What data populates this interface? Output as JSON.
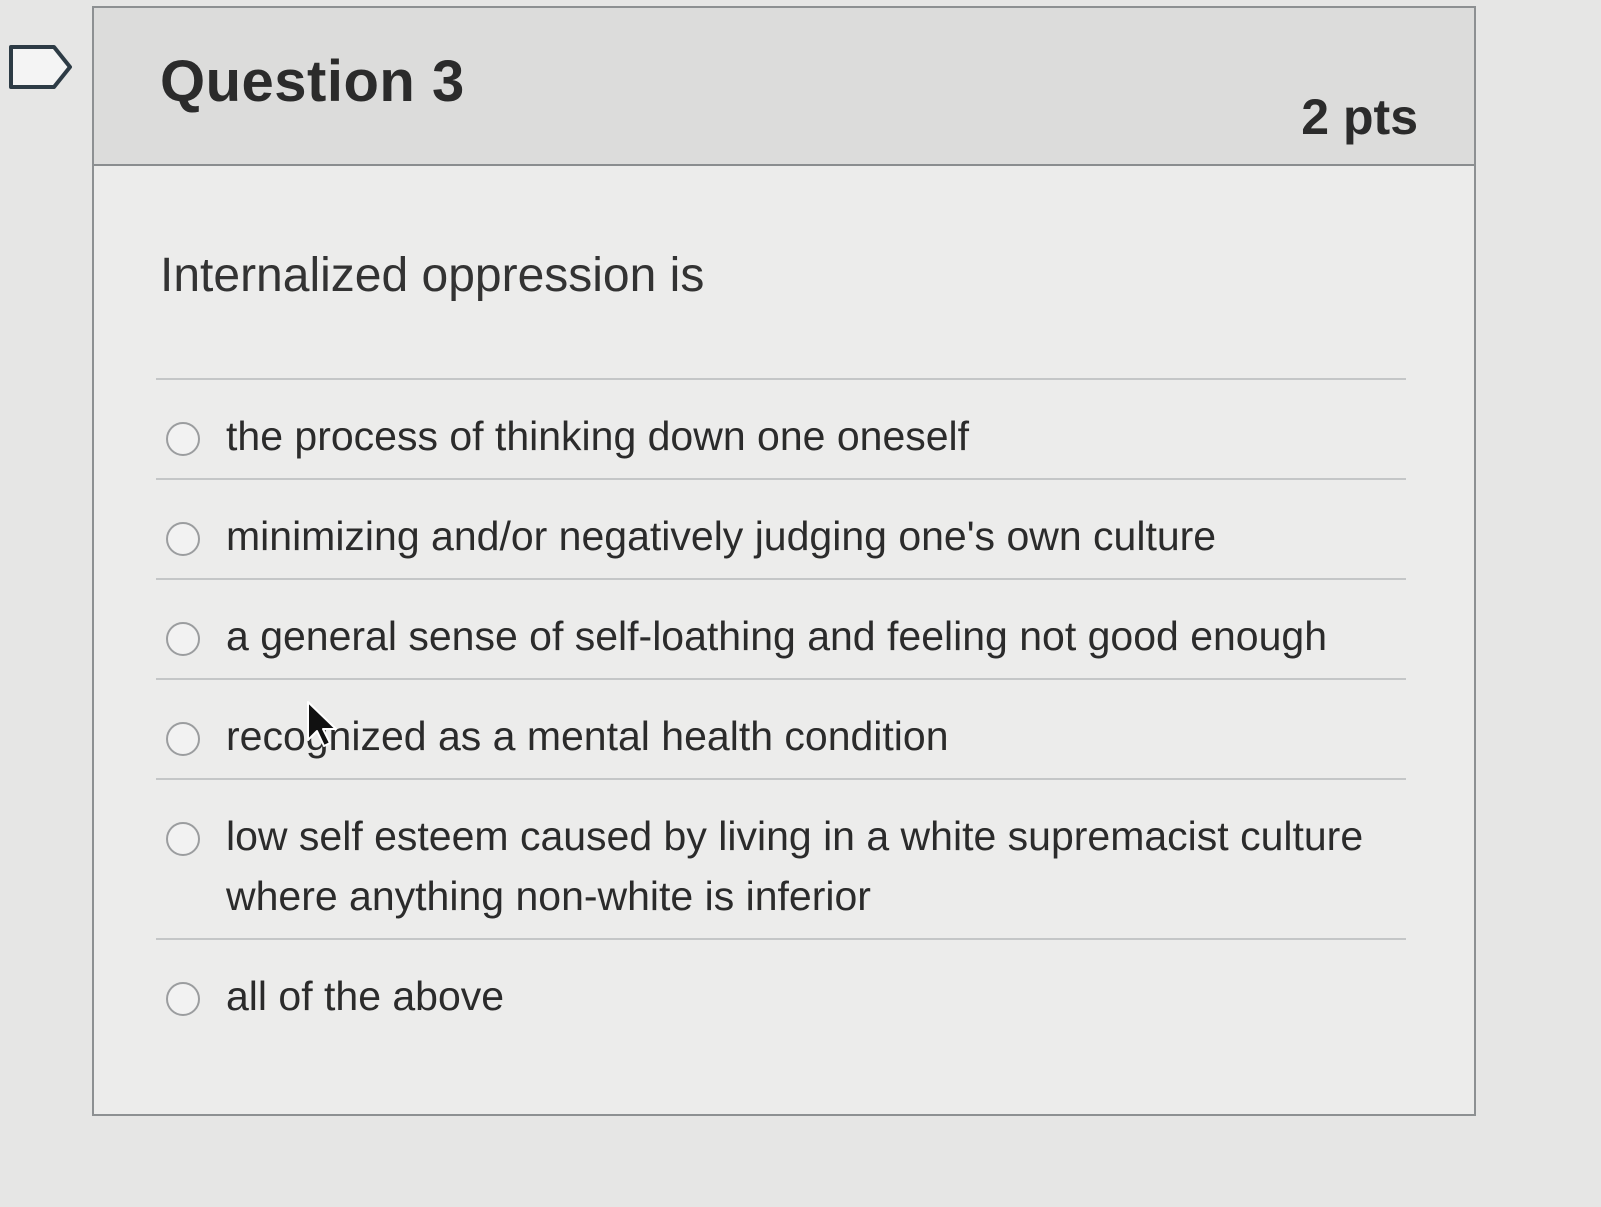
{
  "question": {
    "title": "Question 3",
    "points": "2 pts",
    "text": "Internalized oppression is"
  },
  "answers": [
    {
      "label": "the process of thinking down one oneself",
      "selected": false
    },
    {
      "label": "minimizing and/or negatively judging one's own culture",
      "selected": false
    },
    {
      "label": "a general sense of self-loathing and feeling not good enough",
      "selected": false
    },
    {
      "label": "recognized as a mental health condition",
      "selected": false
    },
    {
      "label": "low self esteem caused by living in a white supremacist culture where anything non-white is inferior",
      "selected": false
    },
    {
      "label": "all of the above",
      "selected": false
    }
  ],
  "icons": {
    "flag": "flag-outline-icon",
    "cursor": "mouse-pointer-icon"
  }
}
